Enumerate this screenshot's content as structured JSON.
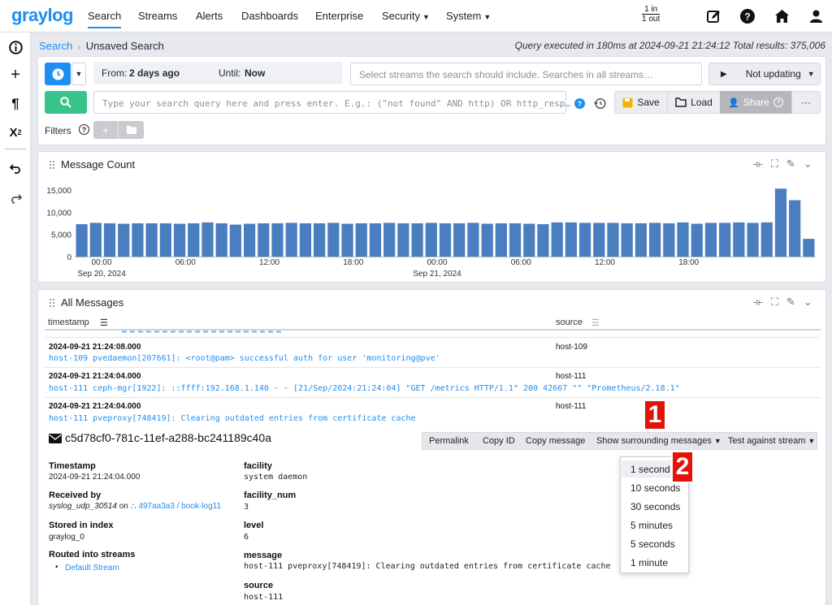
{
  "app": {
    "logo": "graylog"
  },
  "nav": {
    "items": [
      "Search",
      "Streams",
      "Alerts",
      "Dashboards",
      "Enterprise",
      "Security",
      "System"
    ],
    "throughput_in": "1 in",
    "throughput_out": "1 out"
  },
  "breadcrumb": {
    "root": "Search",
    "current": "Unsaved Search"
  },
  "query_info": "Query executed in 180ms at 2024-09-21 21:24:12 Total results: 375,006",
  "search": {
    "from_label": "From:",
    "from_value": "2 days ago",
    "until_label": "Until:",
    "until_value": "Now",
    "streams_placeholder": "Select streams the search should include. Searches in all streams…",
    "update_label": "Not updating",
    "query_placeholder": "Type your search query here and press enter. E.g.: (\"not found\" AND http) OR http_resp…",
    "save_label": "Save",
    "load_label": "Load",
    "share_label": "Share",
    "more_label": "···",
    "filters_label": "Filters",
    "filter_add": "+"
  },
  "message_count": {
    "title": "Message Count",
    "chart_data": {
      "type": "bar",
      "yticks": [
        "15,000",
        "10,000",
        "5,000",
        "0"
      ],
      "ylim": [
        0,
        17000
      ],
      "xticks": [
        {
          "time": "00:00",
          "date": "Sep 20, 2024"
        },
        {
          "time": "06:00",
          "date": ""
        },
        {
          "time": "12:00",
          "date": ""
        },
        {
          "time": "18:00",
          "date": ""
        },
        {
          "time": "00:00",
          "date": "Sep 21, 2024"
        },
        {
          "time": "06:00",
          "date": ""
        },
        {
          "time": "12:00",
          "date": ""
        },
        {
          "time": "18:00",
          "date": ""
        }
      ],
      "values": [
        7300,
        7600,
        7500,
        7400,
        7500,
        7500,
        7500,
        7400,
        7500,
        7700,
        7500,
        7200,
        7400,
        7500,
        7500,
        7600,
        7500,
        7500,
        7600,
        7400,
        7500,
        7500,
        7600,
        7500,
        7500,
        7600,
        7500,
        7500,
        7600,
        7400,
        7500,
        7500,
        7400,
        7300,
        7700,
        7700,
        7600,
        7600,
        7600,
        7500,
        7500,
        7600,
        7500,
        7700,
        7400,
        7600,
        7600,
        7700,
        7600,
        7700,
        15300,
        12700,
        4000
      ]
    }
  },
  "all_messages": {
    "title": "All Messages",
    "col_timestamp": "timestamp",
    "col_source": "source",
    "rows": [
      {
        "timestamp": "2024-09-21 21:24:08.000",
        "message": "host-109 pvedaemon[207661]: <root@pam> successful auth for user 'monitoring@pve'",
        "source": "host-109"
      },
      {
        "timestamp": "2024-09-21 21:24:04.000",
        "message": "host-111 ceph-mgr[1922]: ::ffff:192.168.1.140 - - [21/Sep/2024:21:24:04] \"GET /metrics HTTP/1.1\" 200 42667 \"\" \"Prometheus/2.18.1\"",
        "source": "host-111"
      },
      {
        "timestamp": "2024-09-21 21:24:04.000",
        "message": "host-111 pveproxy[748419]: Clearing outdated entries from certificate cache",
        "source": "host-111"
      }
    ]
  },
  "detail": {
    "message_id": "c5d78cf0-781c-11ef-a288-bc241189c40a",
    "actions": [
      "Permalink",
      "Copy ID",
      "Copy message",
      "Show surrounding messages",
      "Test against stream"
    ],
    "timestamp_label": "Timestamp",
    "timestamp_value": "2024-09-21 21:24:04.000",
    "received_label": "Received by",
    "received_input": "syslog_udp_30514",
    "received_on": "on",
    "received_node": "497aa3a3 / book-log11",
    "index_label": "Stored in index",
    "index_value": "graylog_0",
    "streams_label": "Routed into streams",
    "streams_value": "Default Stream",
    "fields": [
      {
        "name": "facility",
        "value": "system daemon"
      },
      {
        "name": "facility_num",
        "value": "3"
      },
      {
        "name": "level",
        "value": "6"
      },
      {
        "name": "message",
        "value": "host-111 pveproxy[748419]: Clearing outdated entries from certificate cache"
      },
      {
        "name": "source",
        "value": "host-111"
      }
    ]
  },
  "surrounding_menu": [
    "1 second",
    "10 seconds",
    "30 seconds",
    "5 minutes",
    "5 seconds",
    "1 minute"
  ],
  "annotations": {
    "badge1": "1",
    "badge2": "2"
  },
  "colors": {
    "accent": "#1f8ef1",
    "bar": "#4a7ec0",
    "search_green": "#38c38a",
    "badge_red": "#e3120b"
  }
}
